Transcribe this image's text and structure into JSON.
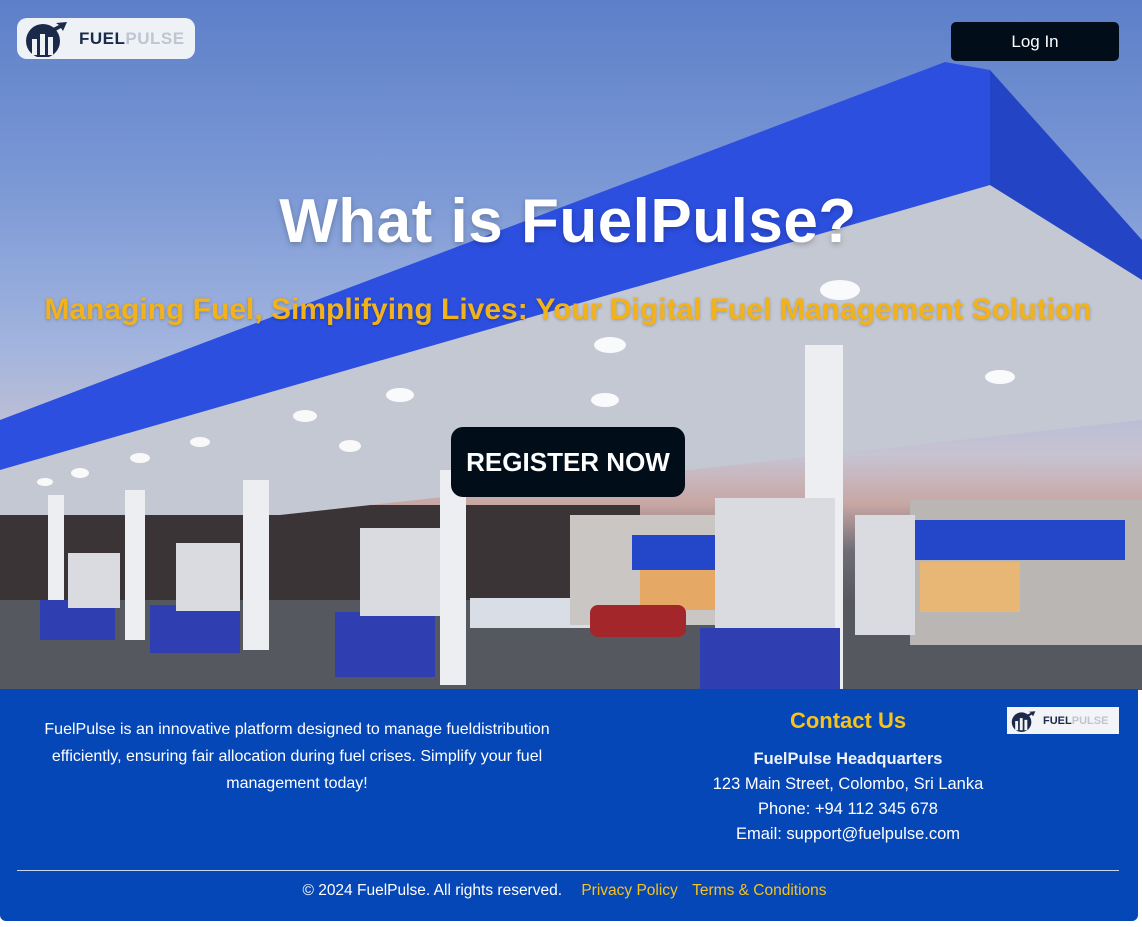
{
  "header": {
    "logo_text_1": "FUEL",
    "logo_text_2": "PULSE",
    "login_label": "Log In"
  },
  "hero": {
    "title": "What is FuelPulse?",
    "subtitle": "Managing Fuel, Simplifying Lives: Your Digital Fuel Management Solution",
    "register_label": "REGISTER NOW"
  },
  "footer": {
    "about": "FuelPulse is an innovative platform designed to manage fueldistribution efficiently, ensuring fair allocation during fuel crises. Simplify your fuel management today!",
    "contact_title": "Contact Us",
    "headquarters": "FuelPulse Headquarters",
    "address": "123 Main Street, Colombo, Sri Lanka",
    "phone": "Phone: +94 112 345 678",
    "email": "Email: support@fuelpulse.com",
    "logo_text_1": "FUEL",
    "logo_text_2": "PULSE",
    "copyright": "© 2024 FuelPulse. All rights reserved.",
    "links": [
      "Privacy Policy",
      "Terms & Conditions"
    ]
  },
  "colors": {
    "accent_yellow": "#f2b21c",
    "footer_blue": "#0547b6",
    "button_dark": "#020d1a"
  },
  "icons": [
    "fuelpulse-logo-icon"
  ]
}
